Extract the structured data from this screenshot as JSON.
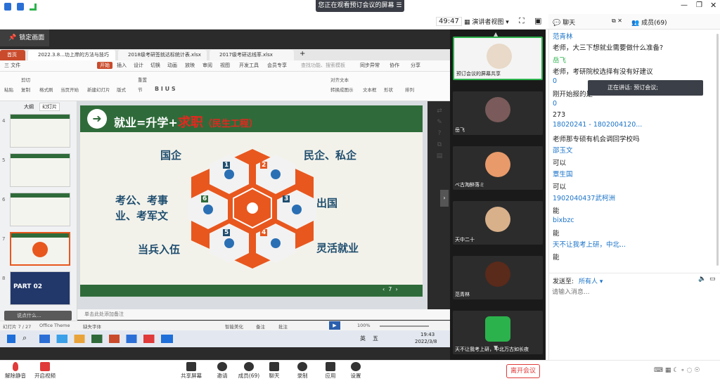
{
  "window": {
    "banner": "您正在观看预订会议的屏幕",
    "timer": "49:47",
    "view_mode": "演讲者视图"
  },
  "share": {
    "lock_label": "锁定画面",
    "wps_tabs": [
      "首页",
      "2022.3.8...功上岸的方法与技巧",
      "2018级考研签就达标统计表.xlsx",
      "2017级考研达线率.xlsx"
    ],
    "menu": [
      "三 文件",
      "开始",
      "插入",
      "设计",
      "切换",
      "动画",
      "放映",
      "审阅",
      "视图",
      "开发工具",
      "会员专享",
      "查找功能、搜索模板",
      "同步异常",
      "协作",
      "分享"
    ],
    "ribbon": [
      "粘贴",
      "剪切",
      "复制",
      "格式刷",
      "当页开始",
      "新建幻灯片",
      "版式",
      "节",
      "重置",
      "文本框",
      "形状",
      "排列",
      "对齐文本",
      "转换成图示"
    ],
    "thumb_tabs": [
      "大纲",
      "幻灯片"
    ],
    "thumb_numbers": [
      "4",
      "5",
      "6",
      "7",
      "8"
    ],
    "thumb_part_title": "PART 02",
    "slide": {
      "title_pre": "就业=升学+",
      "title_red": "求职",
      "title_sub": "（民生工程）",
      "labels": [
        "国企",
        "民企、私企",
        "考公、考事",
        "业、考军文",
        "出国",
        "当兵入伍",
        "灵活就业"
      ],
      "hex_numbers": [
        "1",
        "2",
        "3",
        "4",
        "5",
        "6"
      ],
      "page": "7"
    },
    "notes": "单击此处添加备注",
    "comment_box": "说点什么...",
    "status_left": "幻灯片 7 / 27",
    "status_theme": "Office Theme",
    "status_font": "缺失字体",
    "status_right": [
      "智能美化",
      "备注",
      "批注"
    ],
    "zoom": "100%",
    "taskbar": {
      "time": "19:43",
      "date": "2022/3/8",
      "ime": "英",
      "num": "五"
    }
  },
  "videos": [
    {
      "name": "预订会议的屏幕共享"
    },
    {
      "name": "岳飞"
    },
    {
      "name": "ベ古淘醉落ミ"
    },
    {
      "name": "天中二十"
    },
    {
      "name": "范青林"
    },
    {
      "name": "天不让我考上研，中北万古如长夜"
    }
  ],
  "chat": {
    "tab_chat": "聊天",
    "tab_members": "成员(69)",
    "messages": [
      {
        "name": "范青林",
        "text": "老师，大三下想就业需要做什么准备?"
      },
      {
        "name": "岳飞",
        "text": "老师，考研院校选择有没有好建议"
      },
      {
        "name": "0",
        "text": "刚开始报的是"
      },
      {
        "name": "0",
        "text": "273"
      },
      {
        "name": "18020241 - 1802004120...",
        "text": "老师那专硕有机会调回学校吗"
      },
      {
        "name": "邵玉文",
        "text": "可以"
      },
      {
        "name": "覃生国",
        "text": "可以"
      },
      {
        "name": "1902040437武柯洲",
        "text": "能"
      },
      {
        "name": "bixbzc",
        "text": "能"
      },
      {
        "name": "天不让我考上研，中北...",
        "text": "能"
      }
    ],
    "send_to_label": "发送至:",
    "send_to_value": "所有人",
    "input_placeholder": "请输入消息..."
  },
  "toast": "正在讲话: 预订会议;",
  "bottom": {
    "mute": "解除静音",
    "video": "开启视频",
    "share_screen": "共享屏幕",
    "invite": "邀请",
    "members": "成员(69)",
    "chat": "聊天",
    "record": "录制",
    "apps": "应用",
    "settings": "设置",
    "leave": "离开会议"
  },
  "colors": {
    "slide_green": "#2f6b3a",
    "hex_orange": "#e8571e",
    "accent_blue": "#1a73c8",
    "leave_red": "#e03a3a"
  }
}
